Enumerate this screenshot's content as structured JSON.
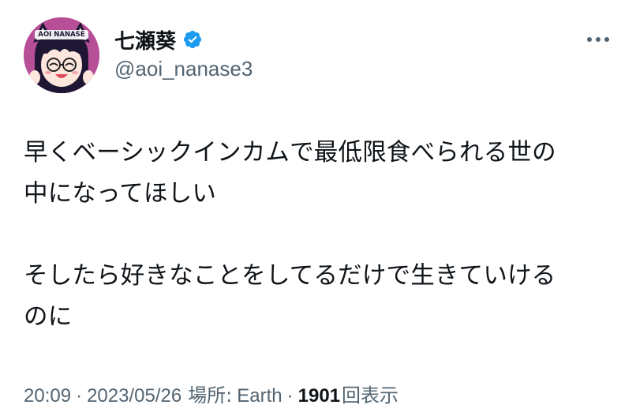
{
  "author": {
    "display_name": "七瀬葵",
    "handle": "@aoi_nanase3",
    "verified": true,
    "avatar_text": "AOI NANASE"
  },
  "tweet": {
    "lines": [
      "早くベーシックインカムで最低限食べられる世の",
      "中になってほしい",
      "",
      "そしたら好きなことをしてるだけで生きていける",
      "のに"
    ]
  },
  "meta": {
    "time": "20:09",
    "date": "2023/05/26",
    "location_label": "場所:",
    "location": "Earth",
    "views_count": "1901",
    "views_label": "回表示",
    "separator": "·"
  },
  "icons": {
    "verified": "verified-badge-icon",
    "more": "more-options-icon"
  },
  "colors": {
    "text": "#0f1419",
    "secondary": "#536471",
    "verified": "#1d9bf0",
    "avatar_bg": "#b64f97"
  }
}
